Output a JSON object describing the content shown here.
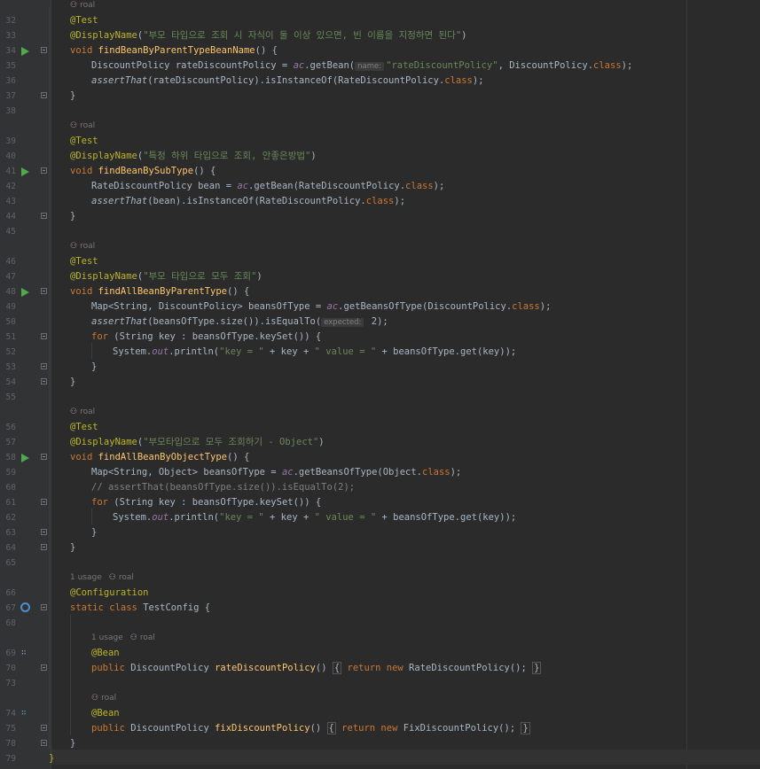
{
  "editor": {
    "author": "roal",
    "usage_label": "1 usage",
    "colors": {
      "keyword": "#cc7832",
      "annotation": "#bbb529",
      "string": "#6a8759",
      "method": "#ffc66d",
      "field": "#9876aa",
      "comment": "#808080"
    }
  },
  "lines": [
    {
      "n": "",
      "hint": "roal"
    },
    {
      "n": "32",
      "tokens": [
        [
          "ann",
          "@Test"
        ]
      ]
    },
    {
      "n": "33",
      "tokens": [
        [
          "ann",
          "@DisplayName"
        ],
        [
          "p",
          "("
        ],
        [
          "str",
          "\"부모 타입으로 조회 시 자식이 둘 이상 있으면, 빈 이름을 지정하면 된다\""
        ],
        [
          "p",
          ")"
        ]
      ]
    },
    {
      "n": "34",
      "run": true,
      "fold": true,
      "tokens": [
        [
          "kw",
          "void "
        ],
        [
          "fn",
          "findBeanByParentTypeBeanName"
        ],
        [
          "p",
          "() {"
        ]
      ]
    },
    {
      "n": "35",
      "indent": 1,
      "tokens": [
        [
          "p",
          "DiscountPolicy rateDiscountPolicy = "
        ],
        [
          "fld",
          "ac"
        ],
        [
          "p",
          ".getBean("
        ],
        [
          "inlay",
          "name:"
        ],
        [
          "str",
          "\"rateDiscountPolicy\""
        ],
        [
          "p",
          ", DiscountPolicy."
        ],
        [
          "kw",
          "class"
        ],
        [
          "p",
          ");"
        ]
      ]
    },
    {
      "n": "36",
      "indent": 1,
      "tokens": [
        [
          "stat",
          "assertThat"
        ],
        [
          "p",
          "(rateDiscountPolicy).isInstanceOf(RateDiscountPolicy."
        ],
        [
          "kw",
          "class"
        ],
        [
          "p",
          ");"
        ]
      ]
    },
    {
      "n": "37",
      "fold": true,
      "tokens": [
        [
          "p",
          "}"
        ]
      ]
    },
    {
      "n": "38",
      "tokens": []
    },
    {
      "n": "",
      "hint": "roal"
    },
    {
      "n": "39",
      "tokens": [
        [
          "ann",
          "@Test"
        ]
      ]
    },
    {
      "n": "40",
      "tokens": [
        [
          "ann",
          "@DisplayName"
        ],
        [
          "p",
          "("
        ],
        [
          "str",
          "\"특정 하위 타입으로 조회, 안좋은방법\""
        ],
        [
          "p",
          ")"
        ]
      ]
    },
    {
      "n": "41",
      "run": true,
      "fold": true,
      "tokens": [
        [
          "kw",
          "void "
        ],
        [
          "fn",
          "findBeanBySubType"
        ],
        [
          "p",
          "() {"
        ]
      ]
    },
    {
      "n": "42",
      "indent": 1,
      "tokens": [
        [
          "p",
          "RateDiscountPolicy bean = "
        ],
        [
          "fld",
          "ac"
        ],
        [
          "p",
          ".getBean(RateDiscountPolicy."
        ],
        [
          "kw",
          "class"
        ],
        [
          "p",
          ");"
        ]
      ]
    },
    {
      "n": "43",
      "indent": 1,
      "tokens": [
        [
          "stat",
          "assertThat"
        ],
        [
          "p",
          "(bean).isInstanceOf(RateDiscountPolicy."
        ],
        [
          "kw",
          "class"
        ],
        [
          "p",
          ");"
        ]
      ]
    },
    {
      "n": "44",
      "fold": true,
      "tokens": [
        [
          "p",
          "}"
        ]
      ]
    },
    {
      "n": "45",
      "tokens": []
    },
    {
      "n": "",
      "hint": "roal"
    },
    {
      "n": "46",
      "tokens": [
        [
          "ann",
          "@Test"
        ]
      ]
    },
    {
      "n": "47",
      "tokens": [
        [
          "ann",
          "@DisplayName"
        ],
        [
          "p",
          "("
        ],
        [
          "str",
          "\"부모 타입으로 모두 조회\""
        ],
        [
          "p",
          ")"
        ]
      ]
    },
    {
      "n": "48",
      "run": true,
      "fold": true,
      "tokens": [
        [
          "kw",
          "void "
        ],
        [
          "fn",
          "findAllBeanByParentType"
        ],
        [
          "p",
          "() {"
        ]
      ]
    },
    {
      "n": "49",
      "indent": 1,
      "tokens": [
        [
          "p",
          "Map<String, DiscountPolicy> beansOfType = "
        ],
        [
          "fld",
          "ac"
        ],
        [
          "p",
          ".getBeansOfType(DiscountPolicy."
        ],
        [
          "kw",
          "class"
        ],
        [
          "p",
          ");"
        ]
      ]
    },
    {
      "n": "50",
      "indent": 1,
      "tokens": [
        [
          "stat",
          "assertThat"
        ],
        [
          "p",
          "(beansOfType.size()).isEqualTo("
        ],
        [
          "inlay",
          "expected:"
        ],
        [
          "p",
          " 2);"
        ]
      ]
    },
    {
      "n": "51",
      "indent": 1,
      "fold": true,
      "tokens": [
        [
          "kw",
          "for "
        ],
        [
          "p",
          "(String key : beansOfType.keySet()) {"
        ]
      ]
    },
    {
      "n": "52",
      "indent": 2,
      "tokens": [
        [
          "p",
          "System."
        ],
        [
          "fld",
          "out"
        ],
        [
          "p",
          ".println("
        ],
        [
          "str",
          "\"key = \""
        ],
        [
          "p",
          " + key + "
        ],
        [
          "str",
          "\" value = \""
        ],
        [
          "p",
          " + beansOfType.get(key));"
        ]
      ]
    },
    {
      "n": "53",
      "indent": 1,
      "fold": true,
      "tokens": [
        [
          "p",
          "}"
        ]
      ]
    },
    {
      "n": "54",
      "fold": true,
      "tokens": [
        [
          "p",
          "}"
        ]
      ]
    },
    {
      "n": "55",
      "tokens": []
    },
    {
      "n": "",
      "hint": "roal"
    },
    {
      "n": "56",
      "tokens": [
        [
          "ann",
          "@Test"
        ]
      ]
    },
    {
      "n": "57",
      "tokens": [
        [
          "ann",
          "@DisplayName"
        ],
        [
          "p",
          "("
        ],
        [
          "str",
          "\"부모타입으로 모두 조회하기 - Object\""
        ],
        [
          "p",
          ")"
        ]
      ]
    },
    {
      "n": "58",
      "run": true,
      "fold": true,
      "tokens": [
        [
          "kw",
          "void "
        ],
        [
          "fn",
          "findAllBeanByObjectType"
        ],
        [
          "p",
          "() {"
        ]
      ]
    },
    {
      "n": "59",
      "indent": 1,
      "tokens": [
        [
          "p",
          "Map<String, Object> beansOfType = "
        ],
        [
          "fld",
          "ac"
        ],
        [
          "p",
          ".getBeansOfType(Object."
        ],
        [
          "kw",
          "class"
        ],
        [
          "p",
          ");"
        ]
      ]
    },
    {
      "n": "60",
      "indent": 1,
      "tokens": [
        [
          "cmt",
          "// assertThat(beansOfType.size()).isEqualTo(2);"
        ]
      ]
    },
    {
      "n": "61",
      "indent": 1,
      "fold": true,
      "tokens": [
        [
          "kw",
          "for "
        ],
        [
          "p",
          "(String key : beansOfType.keySet()) {"
        ]
      ]
    },
    {
      "n": "62",
      "indent": 2,
      "tokens": [
        [
          "p",
          "System."
        ],
        [
          "fld",
          "out"
        ],
        [
          "p",
          ".println("
        ],
        [
          "str",
          "\"key = \""
        ],
        [
          "p",
          " + key + "
        ],
        [
          "str",
          "\" value = \""
        ],
        [
          "p",
          " + beansOfType.get(key));"
        ]
      ]
    },
    {
      "n": "63",
      "indent": 1,
      "fold": true,
      "tokens": [
        [
          "p",
          "}"
        ]
      ]
    },
    {
      "n": "64",
      "fold": true,
      "tokens": [
        [
          "p",
          "}"
        ]
      ]
    },
    {
      "n": "65",
      "tokens": []
    },
    {
      "n": "",
      "hint": "usage"
    },
    {
      "n": "66",
      "tokens": [
        [
          "ann",
          "@Configuration"
        ]
      ]
    },
    {
      "n": "67",
      "cfg": true,
      "fold": true,
      "tokens": [
        [
          "kw",
          "static class "
        ],
        [
          "p",
          "TestConfig {"
        ]
      ]
    },
    {
      "n": "68",
      "tokens": []
    },
    {
      "n": "",
      "indent": 1,
      "hint": "usage"
    },
    {
      "n": "69",
      "bean": true,
      "indent": 1,
      "tokens": [
        [
          "ann",
          "@Bean"
        ]
      ]
    },
    {
      "n": "70",
      "fold": true,
      "indent": 1,
      "tokens": [
        [
          "kw",
          "public "
        ],
        [
          "p",
          "DiscountPolicy "
        ],
        [
          "fn",
          "rateDiscountPolicy"
        ],
        [
          "p",
          "() "
        ],
        [
          "fb",
          "{"
        ],
        [
          "kw",
          " return new "
        ],
        [
          "p",
          "RateDiscountPolicy(); "
        ],
        [
          "fb",
          "}"
        ]
      ]
    },
    {
      "n": "73",
      "tokens": []
    },
    {
      "n": "",
      "indent": 1,
      "hint": "roal"
    },
    {
      "n": "74",
      "bean": true,
      "indent": 1,
      "tokens": [
        [
          "ann",
          "@Bean"
        ]
      ]
    },
    {
      "n": "75",
      "fold": true,
      "indent": 1,
      "tokens": [
        [
          "kw",
          "public "
        ],
        [
          "p",
          "DiscountPolicy "
        ],
        [
          "fn",
          "fixDiscountPolicy"
        ],
        [
          "p",
          "() "
        ],
        [
          "fb",
          "{"
        ],
        [
          "kw",
          " return new "
        ],
        [
          "p",
          "FixDiscountPolicy(); "
        ],
        [
          "fb",
          "}"
        ]
      ]
    },
    {
      "n": "78",
      "fold": true,
      "tokens": [
        [
          "p",
          "}"
        ]
      ]
    },
    {
      "n": "79",
      "closing": true,
      "tokens": [
        [
          "ann",
          "}"
        ]
      ]
    }
  ]
}
